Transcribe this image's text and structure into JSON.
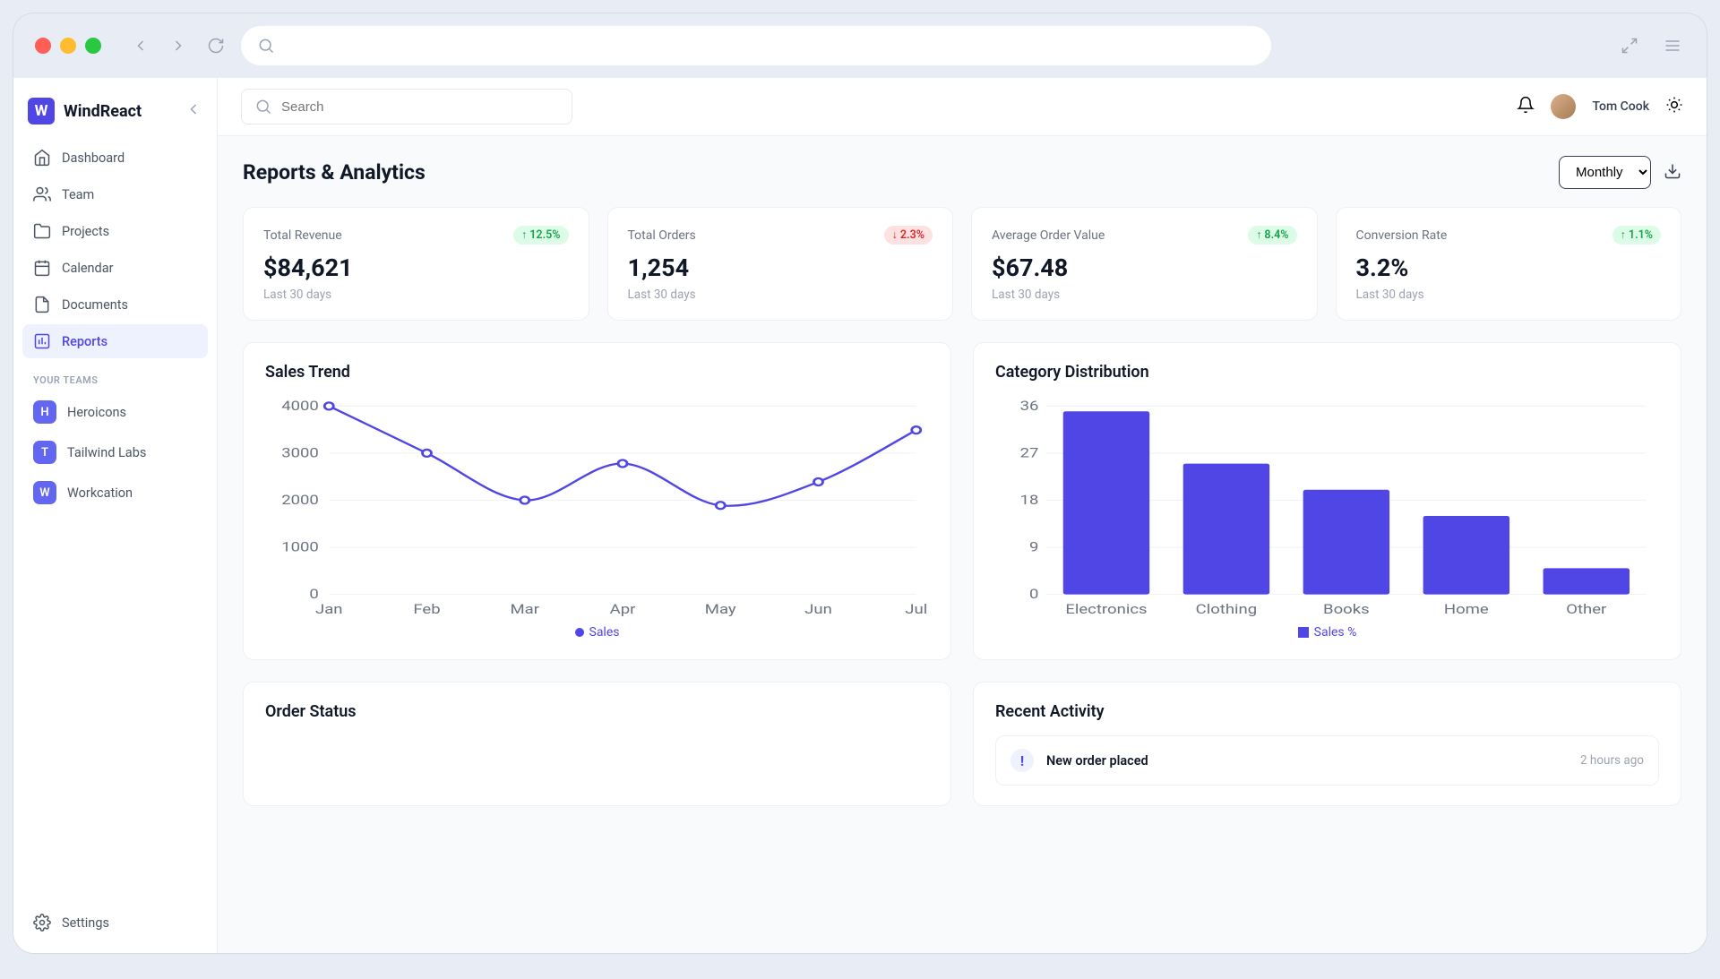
{
  "browser": {
    "url_placeholder": ""
  },
  "brand": {
    "logo_letter": "W",
    "name": "WindReact"
  },
  "sidebar": {
    "items": [
      {
        "label": "Dashboard",
        "icon": "home"
      },
      {
        "label": "Team",
        "icon": "users"
      },
      {
        "label": "Projects",
        "icon": "folder"
      },
      {
        "label": "Calendar",
        "icon": "calendar"
      },
      {
        "label": "Documents",
        "icon": "document"
      },
      {
        "label": "Reports",
        "icon": "chart",
        "active": true
      }
    ],
    "teams_heading": "YOUR TEAMS",
    "teams": [
      {
        "letter": "H",
        "label": "Heroicons"
      },
      {
        "letter": "T",
        "label": "Tailwind Labs"
      },
      {
        "letter": "W",
        "label": "Workcation"
      }
    ],
    "settings_label": "Settings"
  },
  "topbar": {
    "search_placeholder": "Search",
    "user_name": "Tom Cook"
  },
  "page": {
    "title": "Reports & Analytics",
    "period_options": [
      "Monthly"
    ],
    "period_selected": "Monthly"
  },
  "stats": [
    {
      "label": "Total Revenue",
      "value": "$84,621",
      "sub": "Last 30 days",
      "badge": "12.5%",
      "dir": "up"
    },
    {
      "label": "Total Orders",
      "value": "1,254",
      "sub": "Last 30 days",
      "badge": "2.3%",
      "dir": "down"
    },
    {
      "label": "Average Order Value",
      "value": "$67.48",
      "sub": "Last 30 days",
      "badge": "8.4%",
      "dir": "up"
    },
    {
      "label": "Conversion Rate",
      "value": "3.2%",
      "sub": "Last 30 days",
      "badge": "1.1%",
      "dir": "up"
    }
  ],
  "charts": {
    "sales_trend": {
      "title": "Sales Trend",
      "legend": "Sales"
    },
    "category_dist": {
      "title": "Category Distribution",
      "legend": "Sales %"
    }
  },
  "panels": {
    "order_status": {
      "title": "Order Status"
    },
    "recent_activity": {
      "title": "Recent Activity",
      "items": [
        {
          "title": "New order placed",
          "time": "2 hours ago"
        }
      ]
    }
  },
  "chart_data": [
    {
      "type": "line",
      "title": "Sales Trend",
      "xlabel": "",
      "ylabel": "",
      "x": [
        "Jan",
        "Feb",
        "Mar",
        "Apr",
        "May",
        "Jun",
        "Jul"
      ],
      "series": [
        {
          "name": "Sales",
          "values": [
            4000,
            3000,
            2000,
            2780,
            1890,
            2390,
            3490
          ]
        }
      ],
      "ylim": [
        0,
        4000
      ],
      "yticks": [
        0,
        1000,
        2000,
        3000,
        4000
      ]
    },
    {
      "type": "bar",
      "title": "Category Distribution",
      "xlabel": "",
      "ylabel": "",
      "categories": [
        "Electronics",
        "Clothing",
        "Books",
        "Home",
        "Other"
      ],
      "series": [
        {
          "name": "Sales %",
          "values": [
            35,
            25,
            20,
            15,
            5
          ]
        }
      ],
      "ylim": [
        0,
        36
      ],
      "yticks": [
        0,
        9,
        18,
        27,
        36
      ]
    }
  ],
  "colors": {
    "primary": "#4f46e5"
  }
}
